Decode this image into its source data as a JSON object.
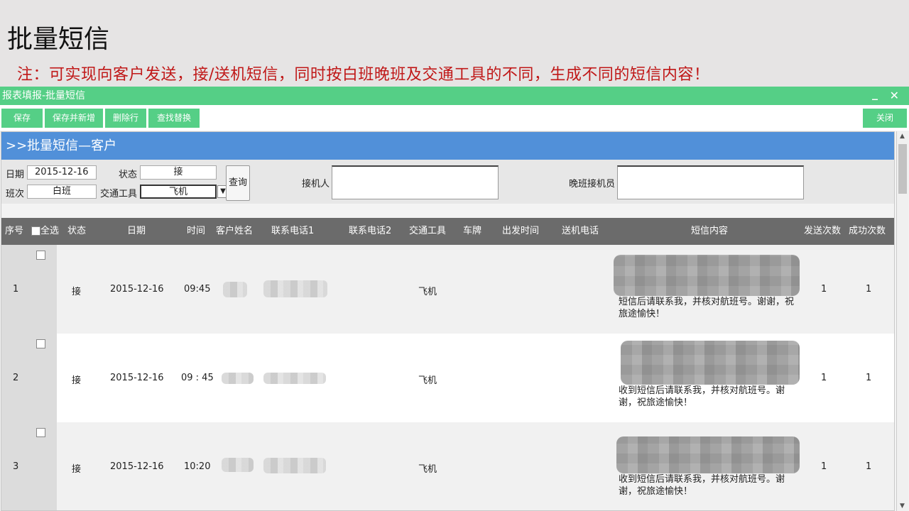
{
  "slide": {
    "title": "批量短信",
    "note": "注：可实现向客户发送，接/送机短信，同时按白班晚班及交通工具的不同，生成不同的短信内容！"
  },
  "window": {
    "title": "报表填报-批量短信",
    "min_icon": "minimize-icon",
    "close_icon": "close-icon"
  },
  "toolbar": {
    "save": "保存",
    "save_new": "保存并新增",
    "delete_row": "删除行",
    "find_replace": "查找替换",
    "close": "关闭"
  },
  "panel": {
    "heading": ">>批量短信—客户"
  },
  "filters": {
    "date_label": "日期",
    "date_value": "2015-12-16",
    "status_label": "状态",
    "status_value": "接",
    "shift_label": "班次",
    "shift_value": "白班",
    "transport_label": "交通工具",
    "transport_value": "飞机",
    "query_button": "查询",
    "pickup_label": "接机人",
    "pickup_value": "",
    "night_pickup_label": "晚班接机员",
    "night_pickup_value": ""
  },
  "table": {
    "headers": {
      "index": "序号",
      "select_all": "全选",
      "status": "状态",
      "date": "日期",
      "time": "时间",
      "customer": "客户姓名",
      "phone1": "联系电话1",
      "phone2": "联系电话2",
      "transport": "交通工具",
      "plate": "车牌",
      "depart_time": "出发时间",
      "dropoff_phone": "送机电话",
      "sms": "短信内容",
      "send_count": "发送次数",
      "success_count": "成功次数"
    },
    "rows": [
      {
        "index": "1",
        "status": "接",
        "date": "2015-12-16",
        "time": "09:45",
        "transport": "飞机",
        "sms": "短信后请联系我，并核对航班号。谢谢，祝旅途愉快！",
        "send_count": "1",
        "success_count": "1"
      },
      {
        "index": "2",
        "status": "接",
        "date": "2015-12-16",
        "time": "09 : 45",
        "transport": "飞机",
        "sms": "收到短信后请联系我，并核对航班号。谢谢，祝旅途愉快！",
        "send_count": "1",
        "success_count": "1"
      },
      {
        "index": "3",
        "status": "接",
        "date": "2015-12-16",
        "time": "10:20",
        "transport": "飞机",
        "sms": "收到短信后请联系我，并核对航班号。谢谢，祝旅途愉快！",
        "send_count": "1",
        "success_count": "1"
      }
    ]
  },
  "colors": {
    "accent_green": "#55cf86",
    "panel_blue": "#5190d9",
    "note_red": "#c01818",
    "header_gray": "#6b6b6b"
  }
}
